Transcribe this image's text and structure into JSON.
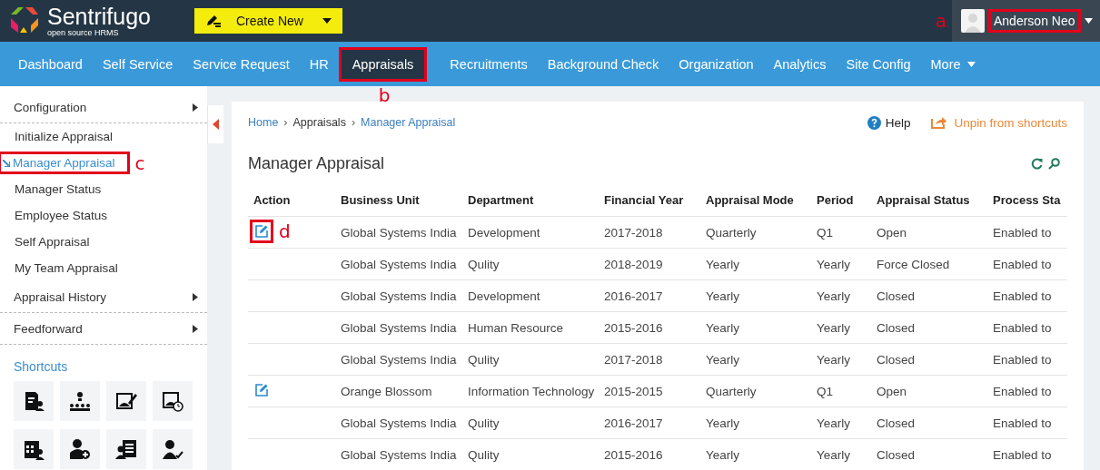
{
  "header": {
    "logo": {
      "name": "Sentrifugo",
      "tagline": "open source HRMS"
    },
    "create_button": "Create New",
    "user": {
      "name": "Anderson Neo",
      "callout": "a"
    }
  },
  "nav": [
    {
      "label": "Dashboard",
      "kind": "link",
      "selected": false
    },
    {
      "label": "Self Service",
      "kind": "link",
      "selected": false
    },
    {
      "label": "Service Request",
      "kind": "link",
      "selected": false
    },
    {
      "label": "HR",
      "kind": "link",
      "selected": false
    },
    {
      "label": "Appraisals",
      "kind": "link",
      "selected": true,
      "callout": "b"
    },
    {
      "label": "Recruitments",
      "kind": "link",
      "selected": false
    },
    {
      "label": "Background Check",
      "kind": "link",
      "selected": false
    },
    {
      "label": "Organization",
      "kind": "link",
      "selected": false
    },
    {
      "label": "Analytics",
      "kind": "link",
      "selected": false
    },
    {
      "label": "Site Config",
      "kind": "link",
      "selected": false
    },
    {
      "label": "More",
      "kind": "dropdown",
      "selected": false
    }
  ],
  "sidebar": {
    "items": [
      {
        "label": "Configuration",
        "kind": "group",
        "selected": false
      },
      {
        "label": "Initialize Appraisal",
        "kind": "link",
        "selected": false
      },
      {
        "label": "Manager Appraisal",
        "kind": "link",
        "selected": true,
        "callout": "c"
      },
      {
        "label": "Manager Status",
        "kind": "link",
        "selected": false
      },
      {
        "label": "Employee Status",
        "kind": "link",
        "selected": false
      },
      {
        "label": "Self Appraisal",
        "kind": "link",
        "selected": false
      },
      {
        "label": "My Team Appraisal",
        "kind": "link",
        "selected": false
      },
      {
        "label": "Appraisal History",
        "kind": "group",
        "selected": false
      },
      {
        "label": "Feedforward",
        "kind": "group",
        "selected": false
      }
    ],
    "shortcuts_title": "Shortcuts"
  },
  "breadcrumb": [
    {
      "label": "Home",
      "kind": "link"
    },
    {
      "label": "›",
      "kind": "separator"
    },
    {
      "label": "Appraisals",
      "kind": "text"
    },
    {
      "label": "›",
      "kind": "separator"
    },
    {
      "label": "Manager Appraisal",
      "kind": "link"
    }
  ],
  "help": "Help",
  "unpin": "Unpin from shortcuts",
  "page_title": "Manager Appraisal",
  "table": {
    "columns": [
      "Action",
      "Business Unit",
      "Department",
      "Financial Year",
      "Appraisal Mode",
      "Period",
      "Appraisal Status",
      "Process Sta"
    ],
    "rows": [
      {
        "editable": true,
        "callout": "d",
        "cells": [
          "",
          "Global Systems India",
          "Development",
          "2017-2018",
          "Quarterly",
          "Q1",
          "Open",
          "Enabled to"
        ]
      },
      {
        "editable": false,
        "cells": [
          "",
          "Global Systems India",
          "Qulity",
          "2018-2019",
          "Yearly",
          "Yearly",
          "Force Closed",
          "Enabled to"
        ]
      },
      {
        "editable": false,
        "cells": [
          "",
          "Global Systems India",
          "Development",
          "2016-2017",
          "Yearly",
          "Yearly",
          "Closed",
          "Enabled to"
        ]
      },
      {
        "editable": false,
        "cells": [
          "",
          "Global Systems India",
          "Human Resource",
          "2015-2016",
          "Yearly",
          "Yearly",
          "Closed",
          "Enabled to"
        ]
      },
      {
        "editable": false,
        "cells": [
          "",
          "Global Systems India",
          "Qulity",
          "2017-2018",
          "Yearly",
          "Yearly",
          "Closed",
          "Enabled to"
        ]
      },
      {
        "editable": true,
        "cells": [
          "",
          "Orange Blossom",
          "Information Technology",
          "2015-2015",
          "Quarterly",
          "Q1",
          "Open",
          "Enabled to"
        ]
      },
      {
        "editable": false,
        "cells": [
          "",
          "Global Systems India",
          "Qulity",
          "2016-2017",
          "Yearly",
          "Yearly",
          "Closed",
          "Enabled to"
        ]
      },
      {
        "editable": false,
        "cells": [
          "",
          "Global Systems India",
          "Qulity",
          "2015-2016",
          "Yearly",
          "Yearly",
          "Closed",
          "Enabled to"
        ]
      }
    ]
  }
}
